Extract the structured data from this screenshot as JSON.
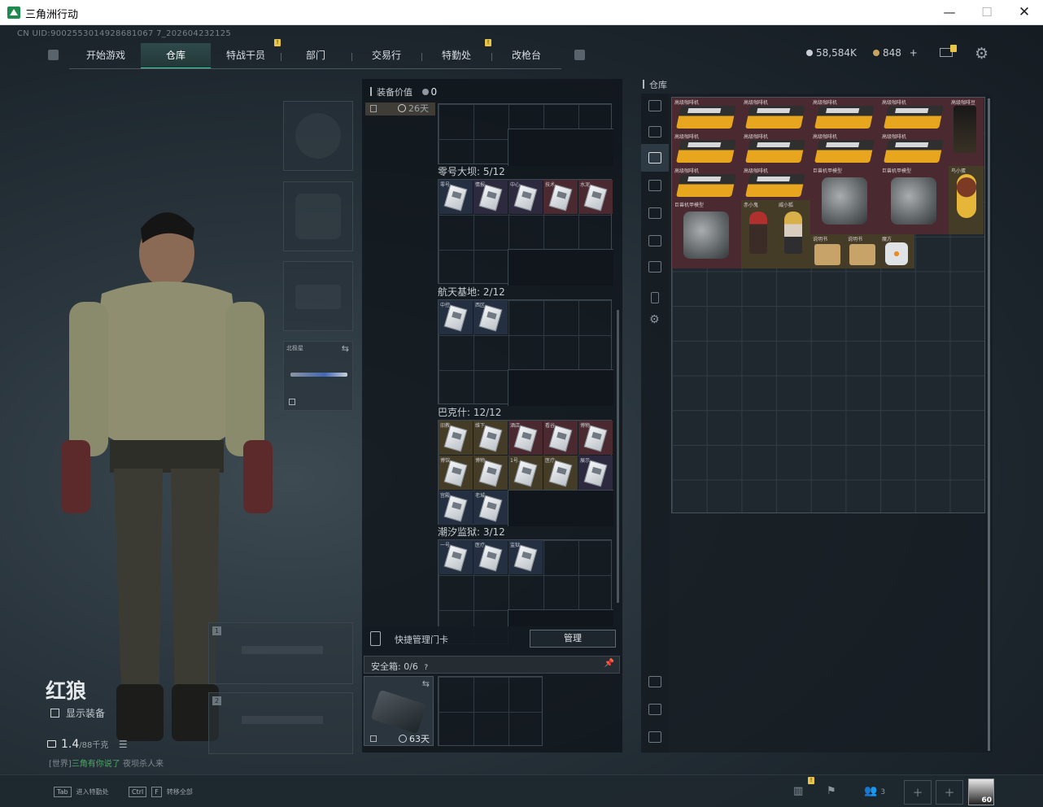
{
  "window": {
    "title": "三角洲行动",
    "min": "—",
    "max": "☐",
    "close": "✕"
  },
  "uid": "CN UID:9002553014928681067 7_202604232125",
  "nav": {
    "left_icon": "menu-icon",
    "tabs": [
      {
        "label": "开始游戏"
      },
      {
        "label": "仓库",
        "active": true
      },
      {
        "label": "特战干员"
      },
      {
        "label": "部门"
      },
      {
        "label": "交易行"
      },
      {
        "label": "特勤处"
      },
      {
        "label": "改枪台"
      }
    ],
    "badge": "!"
  },
  "currency": {
    "coins": "58,584K",
    "tokens": "848",
    "plus": "+"
  },
  "character": {
    "name": "红狼",
    "show_equipment_label": "显示装备",
    "weight": "1.4",
    "weight_max": "/88千克",
    "chat_prefix": "[世界]",
    "chat_highlight": "三角有你说了",
    "chat_text": " 夜坝杀人来"
  },
  "equipment": {
    "melee_label": "北极星",
    "swap": "⇆",
    "weapon_slots": [
      "1",
      "2"
    ]
  },
  "backpack": {
    "equipment_value_label": "装备价值",
    "equipment_value": "0",
    "duration_tag": "26天",
    "cases": [
      {
        "name": "零号大坝: 5/12",
        "items": [
          "零号…",
          "情报…",
          "中心…",
          "技术…",
          "水泥…"
        ]
      },
      {
        "name": "航天基地: 2/12",
        "items": [
          "中控…",
          "西区…"
        ]
      },
      {
        "name": "巴克什: 12/12",
        "items": [
          "旧教…",
          "维下…",
          "酒店…",
          "看谷…",
          "博物…",
          "博馆…",
          "博物…",
          "1号…",
          "医疗…",
          "展示…",
          "宫殿…",
          "老城…"
        ]
      },
      {
        "name": "潮汐监狱: 3/12",
        "items": [
          "一号…",
          "医疗…",
          "监狱…"
        ]
      }
    ],
    "key_manager_label": "快捷管理门卡",
    "manage_button": "管理",
    "safe_box_label": "安全箱: 0/6",
    "safe_box_help": "?",
    "safe_box_days": "63天"
  },
  "warehouse": {
    "label": "仓库",
    "items": [
      "高级咖啡机",
      "高级咖啡机",
      "高级咖啡机",
      "高级咖啡机",
      "高级咖啡豆",
      "高级咖啡机",
      "高级咖啡机",
      "高级咖啡机",
      "高级咖啡机",
      "高级咖啡机",
      "高级咖啡机",
      "巨兽机甲模型",
      "巨兽机甲模型",
      "鸟小蛋",
      "巨兽机甲模型",
      "赤小鬼",
      "威小狐",
      "说明书",
      "说明书",
      "魔方"
    ]
  },
  "bottom": {
    "hint1_key": "Tab",
    "hint1_text": "进入特勤处",
    "hint2_key1": "Ctrl",
    "hint2_key2": "F",
    "hint2_text": "转移全部",
    "squad_count": "3",
    "add": "+",
    "level": "60"
  }
}
